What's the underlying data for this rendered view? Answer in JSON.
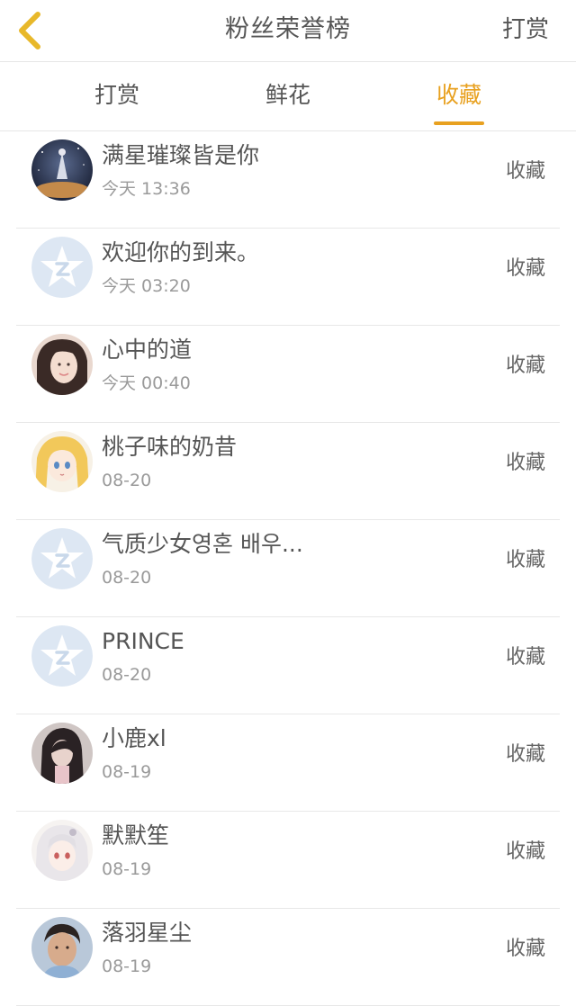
{
  "header": {
    "title": "粉丝荣誉榜",
    "action_label": "打赏",
    "accent_color": "#e8a120"
  },
  "tabs": [
    {
      "label": "打赏"
    },
    {
      "label": "鲜花"
    },
    {
      "label": "收藏"
    }
  ],
  "active_tab": 2,
  "list": [
    {
      "name": "满星璀璨皆是你",
      "time": "今天 13:36",
      "action": "收藏",
      "avatar": "photo-night-sky-avatar"
    },
    {
      "name": "欢迎你的到来。",
      "time": "今天 03:20",
      "action": "收藏",
      "avatar": "default-star-avatar"
    },
    {
      "name": "心中的道",
      "time": "今天 00:40",
      "action": "收藏",
      "avatar": "photo-girl-avatar"
    },
    {
      "name": "桃子味的奶昔",
      "time": "08-20",
      "action": "收藏",
      "avatar": "anime-girl-avatar"
    },
    {
      "name": "气质少女영혼 배우...",
      "time": "08-20",
      "action": "收藏",
      "avatar": "default-star-avatar"
    },
    {
      "name": "PRINCE",
      "time": "08-20",
      "action": "收藏",
      "avatar": "default-star-avatar"
    },
    {
      "name": "小鹿xl",
      "time": "08-19",
      "action": "收藏",
      "avatar": "photo-girl-dark-avatar"
    },
    {
      "name": "默默笙",
      "time": "08-19",
      "action": "收藏",
      "avatar": "anime-white-hair-avatar"
    },
    {
      "name": "落羽星尘",
      "time": "08-19",
      "action": "收藏",
      "avatar": "photo-boy-avatar"
    }
  ]
}
